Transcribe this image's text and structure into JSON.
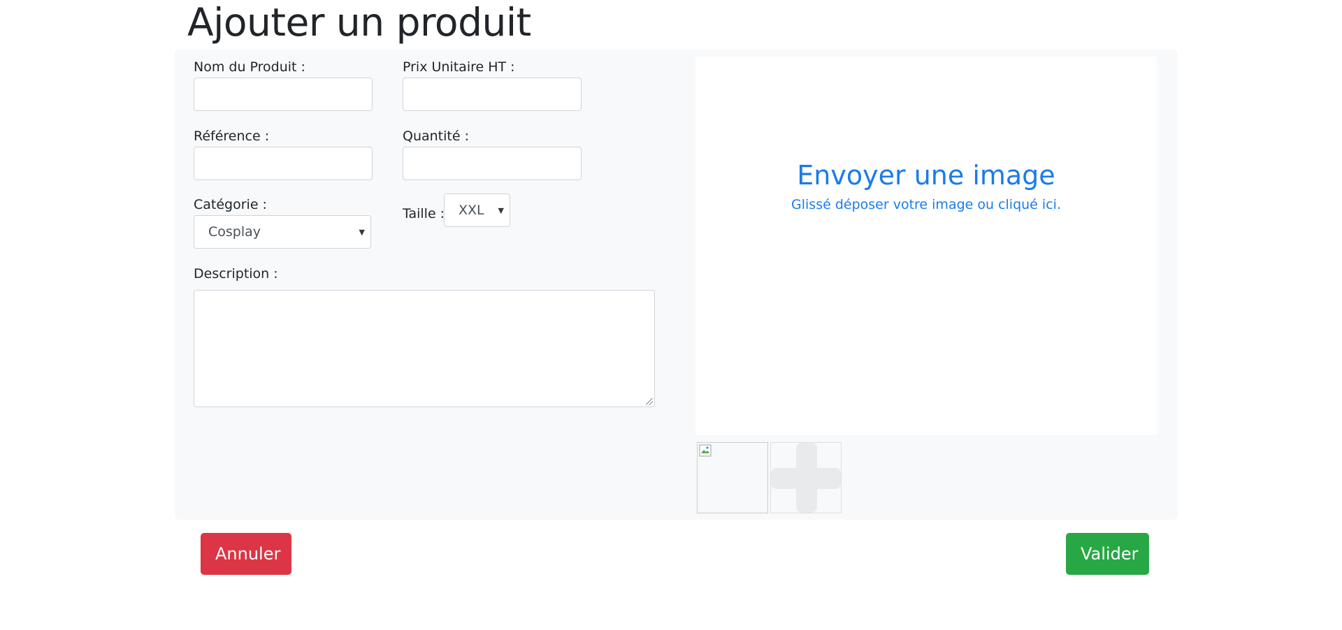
{
  "page": {
    "title": "Ajouter un produit"
  },
  "form": {
    "name": {
      "label": "Nom du Produit :",
      "value": ""
    },
    "price": {
      "label": "Prix Unitaire HT :",
      "value": ""
    },
    "reference": {
      "label": "Référence :",
      "value": ""
    },
    "quantity": {
      "label": "Quantité :",
      "value": ""
    },
    "category": {
      "label": "Catégorie :",
      "selected": "Cosplay"
    },
    "size": {
      "label": "Taille :",
      "selected": "XXL"
    },
    "description": {
      "label": "Description :",
      "value": ""
    }
  },
  "upload": {
    "title": "Envoyer une image",
    "subtitle": "Glissé déposer votre image ou cliqué ici.",
    "thumbnails": [
      {
        "type": "broken-image-icon"
      },
      {
        "type": "add-image-icon"
      }
    ]
  },
  "actions": {
    "cancel_label": "Annuler",
    "submit_label": "Valider"
  },
  "colors": {
    "panel_bg": "#f8f9fa",
    "link_blue": "#1a7bea",
    "danger": "#dc3545",
    "success": "#28a745"
  }
}
